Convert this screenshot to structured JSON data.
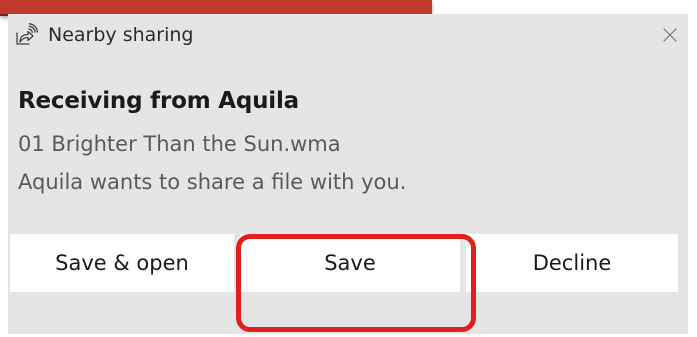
{
  "notification": {
    "app_name": "Nearby sharing",
    "app_icon": "nearby-sharing-icon",
    "close_icon": "close-icon",
    "title": "Receiving from Aquila",
    "file_name": "01 Brighter Than the Sun.wma",
    "message": "Aquila wants to share a file with you."
  },
  "buttons": {
    "save_open_label": "Save & open",
    "save_label": "Save",
    "decline_label": "Decline"
  },
  "colors": {
    "toast_background": "#e5e5e5",
    "button_background": "#ffffff",
    "highlight": "#e0201a"
  }
}
